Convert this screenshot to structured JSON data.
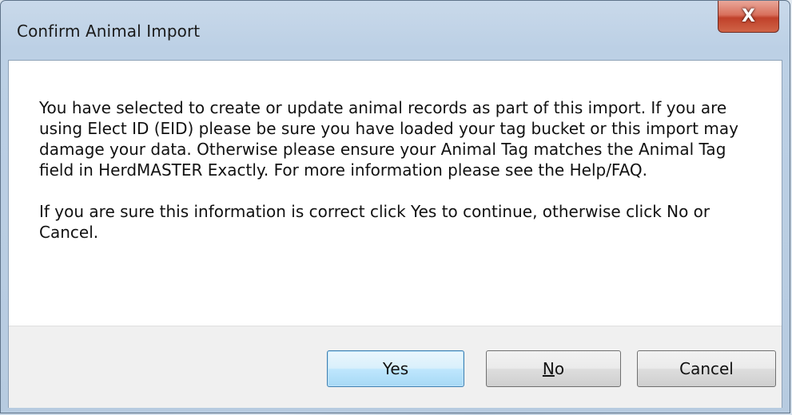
{
  "dialog": {
    "title": "Confirm Animal Import",
    "close_glyph": "X",
    "message_paragraphs": [
      "You have selected to create or update animal records as part of this import. If you are using Elect ID (EID) please be sure you have loaded your tag bucket or this import may damage your data. Otherwise please ensure your Animal Tag matches the Animal Tag field in HerdMASTER Exactly. For more information please see the Help/FAQ.",
      "If you are sure this information is correct click Yes to continue, otherwise click No or Cancel."
    ]
  },
  "buttons": {
    "yes_label": "Yes",
    "no_mnemonic": "N",
    "no_rest": "o",
    "cancel_label": "Cancel"
  },
  "colors": {
    "close_button": "#c7432c",
    "default_button_border": "#3c7fb1",
    "footer_background": "#f0f0f0"
  }
}
